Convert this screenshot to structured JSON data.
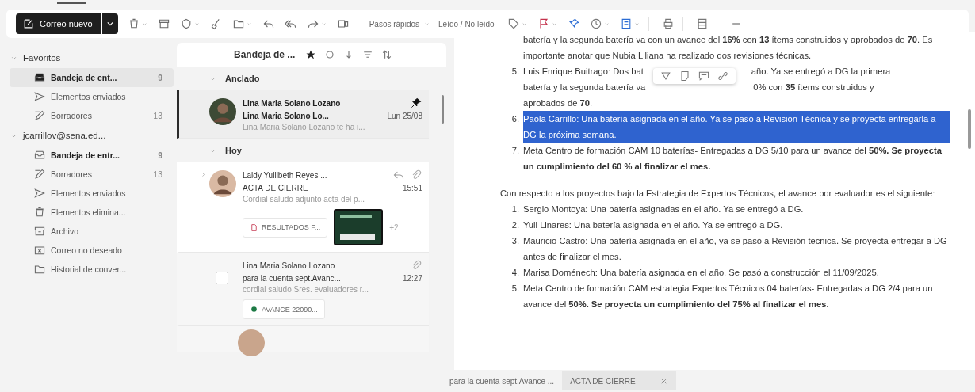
{
  "toolbar": {
    "new_mail": "Correo nuevo",
    "quick_steps": "Pasos rápidos",
    "read_unread": "Leído / No leído"
  },
  "nav": {
    "groups": [
      {
        "title": "Favoritos",
        "expanded": true,
        "items": [
          {
            "label": "Bandeja de ent...",
            "count": "9",
            "selected": true,
            "unread": true
          },
          {
            "label": "Elementos enviados",
            "selected": false,
            "unread": false
          },
          {
            "label": "Borradores",
            "count": "13",
            "selected": false,
            "unread": false
          }
        ]
      },
      {
        "title": "jcarrillov@sena.ed...",
        "expanded": true,
        "items": [
          {
            "label": "Bandeja de entr...",
            "count": "9",
            "selected": false,
            "unread": true
          },
          {
            "label": "Borradores",
            "count": "13",
            "selected": false,
            "unread": false
          },
          {
            "label": "Elementos enviados",
            "selected": false,
            "unread": false
          },
          {
            "label": "Elementos elimina...",
            "selected": false,
            "unread": false
          },
          {
            "label": "Archivo",
            "selected": false,
            "unread": false
          },
          {
            "label": "Correo no deseado",
            "selected": false,
            "unread": false
          },
          {
            "label": "Historial de conver...",
            "selected": false,
            "unread": false
          }
        ]
      }
    ]
  },
  "list": {
    "title": "Bandeja de ...",
    "sections": [
      {
        "title": "Anclado",
        "messages": [
          {
            "sender": "Lina Maria Solano Lozano",
            "subject": "Lina Maria Solano Lo...",
            "time": "Lun 25/08",
            "preview": "Lina Maria Solano Lozano te ha i...",
            "pinned": true,
            "selected": true,
            "unread": true,
            "kind": "photo"
          }
        ]
      },
      {
        "title": "Hoy",
        "messages": [
          {
            "sender": "Laidy Yullibeth Reyes ...",
            "subject": "ACTA DE CIERRE",
            "time": "15:51",
            "preview": "Cordial saludo adjunto acta del p...",
            "pinned": false,
            "selected": false,
            "unread": false,
            "replied": true,
            "has_attachment": true,
            "kind": "photo",
            "attachments": [
              {
                "kind": "pdf",
                "name": "RESULTADOS F..."
              },
              {
                "kind": "image"
              }
            ],
            "more": "+2"
          },
          {
            "sender": "Lina Maria Solano Lozano",
            "subject": "para la cuenta sept.Avanc...",
            "time": "12:27",
            "preview": "cordial saludo Sres. evaluadores r...",
            "pinned": false,
            "selected": false,
            "unread": false,
            "replied": false,
            "has_attachment": true,
            "kind": "checkbox",
            "attachments": [
              {
                "kind": "sheet",
                "name": "AVANCE 22090..."
              }
            ]
          }
        ]
      }
    ]
  },
  "reading": {
    "blocks": [
      {
        "kind": "list",
        "items": [
          {
            "text": "batería y la segunda batería va con un avance del **16%** con **13** ítems construidos y aprobados de **70**. Es importante anotar que Nubia Liliana ha realizado dos revisiones técnicas.",
            "selected": false
          },
          {
            "number": "5.",
            "segments": [
              "Luis Enrique Buitrago: Dos bat",
              "año. Ya se entregó a DG la primera",
              "batería y la segunda batería va",
              "0% con **35** ítems construidos y",
              "aprobados de **70**."
            ]
          },
          {
            "number": "6.",
            "text": "Paola Carrillo: Una batería asignada en el año. Ya se pasó a Revisión Técnica y se proyecta entregarla a DG la próxima semana.",
            "selected": true
          },
          {
            "number": "7.",
            "text": "Meta Centro de formación CAM 10 baterías- Entregadas a DG 5/10 para un avance del **50%. Se proyecta un cumplimiento del 60 % al finalizar el mes.**",
            "selected": false
          }
        ]
      },
      {
        "kind": "paragraph",
        "text": "Con respecto a los proyectos bajo la Estrategia de Expertos Técnicos, el avance por evaluador es el siguiente:"
      },
      {
        "kind": "list",
        "items": [
          {
            "number": "1.",
            "text": "Sergio Montoya: Una batería asignadas en el año. Ya se entregó a DG.",
            "selected": false
          },
          {
            "number": "2.",
            "text": "Yuli Linares: Una batería asignada en el año. Ya se entregó a DG.",
            "selected": false
          },
          {
            "number": "3.",
            "text": "Mauricio Castro: Una batería asignada en el año,  ya se pasó a Revisión técnica. Se proyecta entregar a DG antes de finalizar el mes.",
            "selected": false
          },
          {
            "number": "4.",
            "text": "Marisa Doménech: Una batería asignada en el año. Se pasó a construcción el 11/09/2025.",
            "selected": false
          },
          {
            "number": "5.",
            "text": "Meta Centro de formación CAM estrategia Expertos Técnicos 04 baterías- Entregadas a DG 2/4 para un avance del **50%. Se proyecta un cumplimiento del 75% al finalizar el mes.**",
            "selected": false
          }
        ]
      }
    ]
  },
  "bottom_tabs": [
    {
      "label": "para la cuenta sept.Avance ...",
      "selected": false,
      "closable": false
    },
    {
      "label": "ACTA DE CIERRE",
      "selected": true,
      "closable": true
    }
  ]
}
